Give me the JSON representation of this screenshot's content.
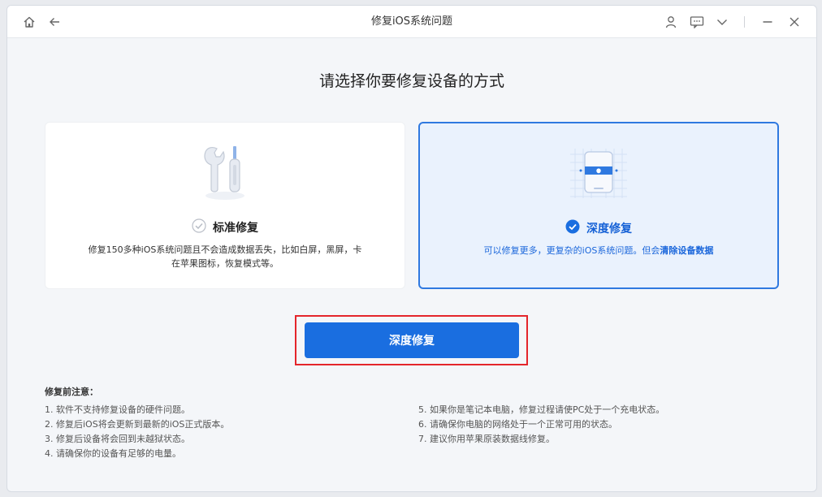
{
  "window": {
    "title": "修复iOS系统问题"
  },
  "titlebar": {
    "left_icons": [
      "home-icon",
      "back-arrow-icon"
    ],
    "right_icons": [
      "user-icon",
      "feedback-icon",
      "chevron-down-icon",
      "minimize-icon",
      "close-icon"
    ]
  },
  "main": {
    "heading": "请选择你要修复设备的方式",
    "standard": {
      "title": "标准修复",
      "desc_line1": "修复150多种iOS系统问题且不会造成数据丢失，比如白屏，黑屏，卡",
      "desc_line2": "在苹果图标，恢复模式等。",
      "selected": false
    },
    "deep": {
      "title": "深度修复",
      "desc_prefix": "可以修复更多，更复杂的iOS系统问题。但会",
      "desc_bold": "清除设备数据",
      "selected": true
    },
    "action_button": "深度修复"
  },
  "notes": {
    "title": "修复前注意：",
    "left": [
      "1.  软件不支持修复设备的硬件问题。",
      "2.  修复后iOS将会更新到最新的iOS正式版本。",
      "3.  修复后设备将会回到未越狱状态。",
      "4.  请确保你的设备有足够的电量。"
    ],
    "right": [
      "5.  如果你是笔记本电脑，修复过程请使PC处于一个充电状态。",
      "6.  请确保你电脑的网络处于一个正常可用的状态。",
      "7.  建议你用苹果原装数据线修复。"
    ]
  },
  "colors": {
    "accent": "#1a6ee0",
    "selected_border": "#2f79e0",
    "highlight": "#e4252b"
  }
}
